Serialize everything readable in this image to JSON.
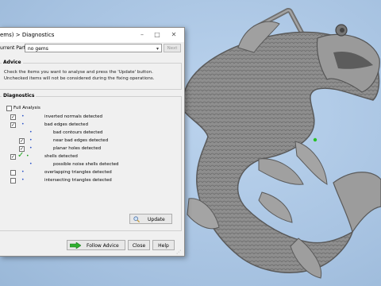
{
  "window": {
    "title": "ems) > Diagnostics",
    "minimize_glyph": "–",
    "maximize_glyph": "□",
    "close_glyph": "✕"
  },
  "part": {
    "label": "urrent Part:",
    "value": "no gems",
    "next_label": "Next"
  },
  "advice": {
    "title": "Advice",
    "text": "Check the items you want to analyse and press the 'Update' button. Unchecked items will not be considered during the fixing operations."
  },
  "diagnostics": {
    "title": "Diagnostics",
    "full_analysis": {
      "label": "Full Analysis",
      "checked": false
    },
    "items": [
      {
        "label": "inverted normals detected",
        "checked": true
      },
      {
        "label": "bad edges detected",
        "checked": true
      },
      {
        "label": "bad contours detected"
      },
      {
        "label": "near bad edges detected",
        "checked": true
      },
      {
        "label": "planar holes detected",
        "checked": true
      },
      {
        "label": "shells detected",
        "checked": true
      },
      {
        "label": "possible noise shells detected"
      },
      {
        "label": "overlapping triangles detected",
        "checked": false
      },
      {
        "label": "intersecting triangles detected",
        "checked": false
      }
    ],
    "update_label": "Update"
  },
  "footer": {
    "follow_advice": "Follow Advice",
    "close": "Close",
    "help": "Help"
  },
  "colors": {
    "viewport_bg": "#a9c6e4",
    "model": "#8c8c8c",
    "check_green": "#1aa31a",
    "bullet_blue": "#2a52c8"
  },
  "icons": {
    "check_mark": "✓",
    "bullet": "•",
    "chevron": "▾",
    "size_grip": "⋰"
  }
}
